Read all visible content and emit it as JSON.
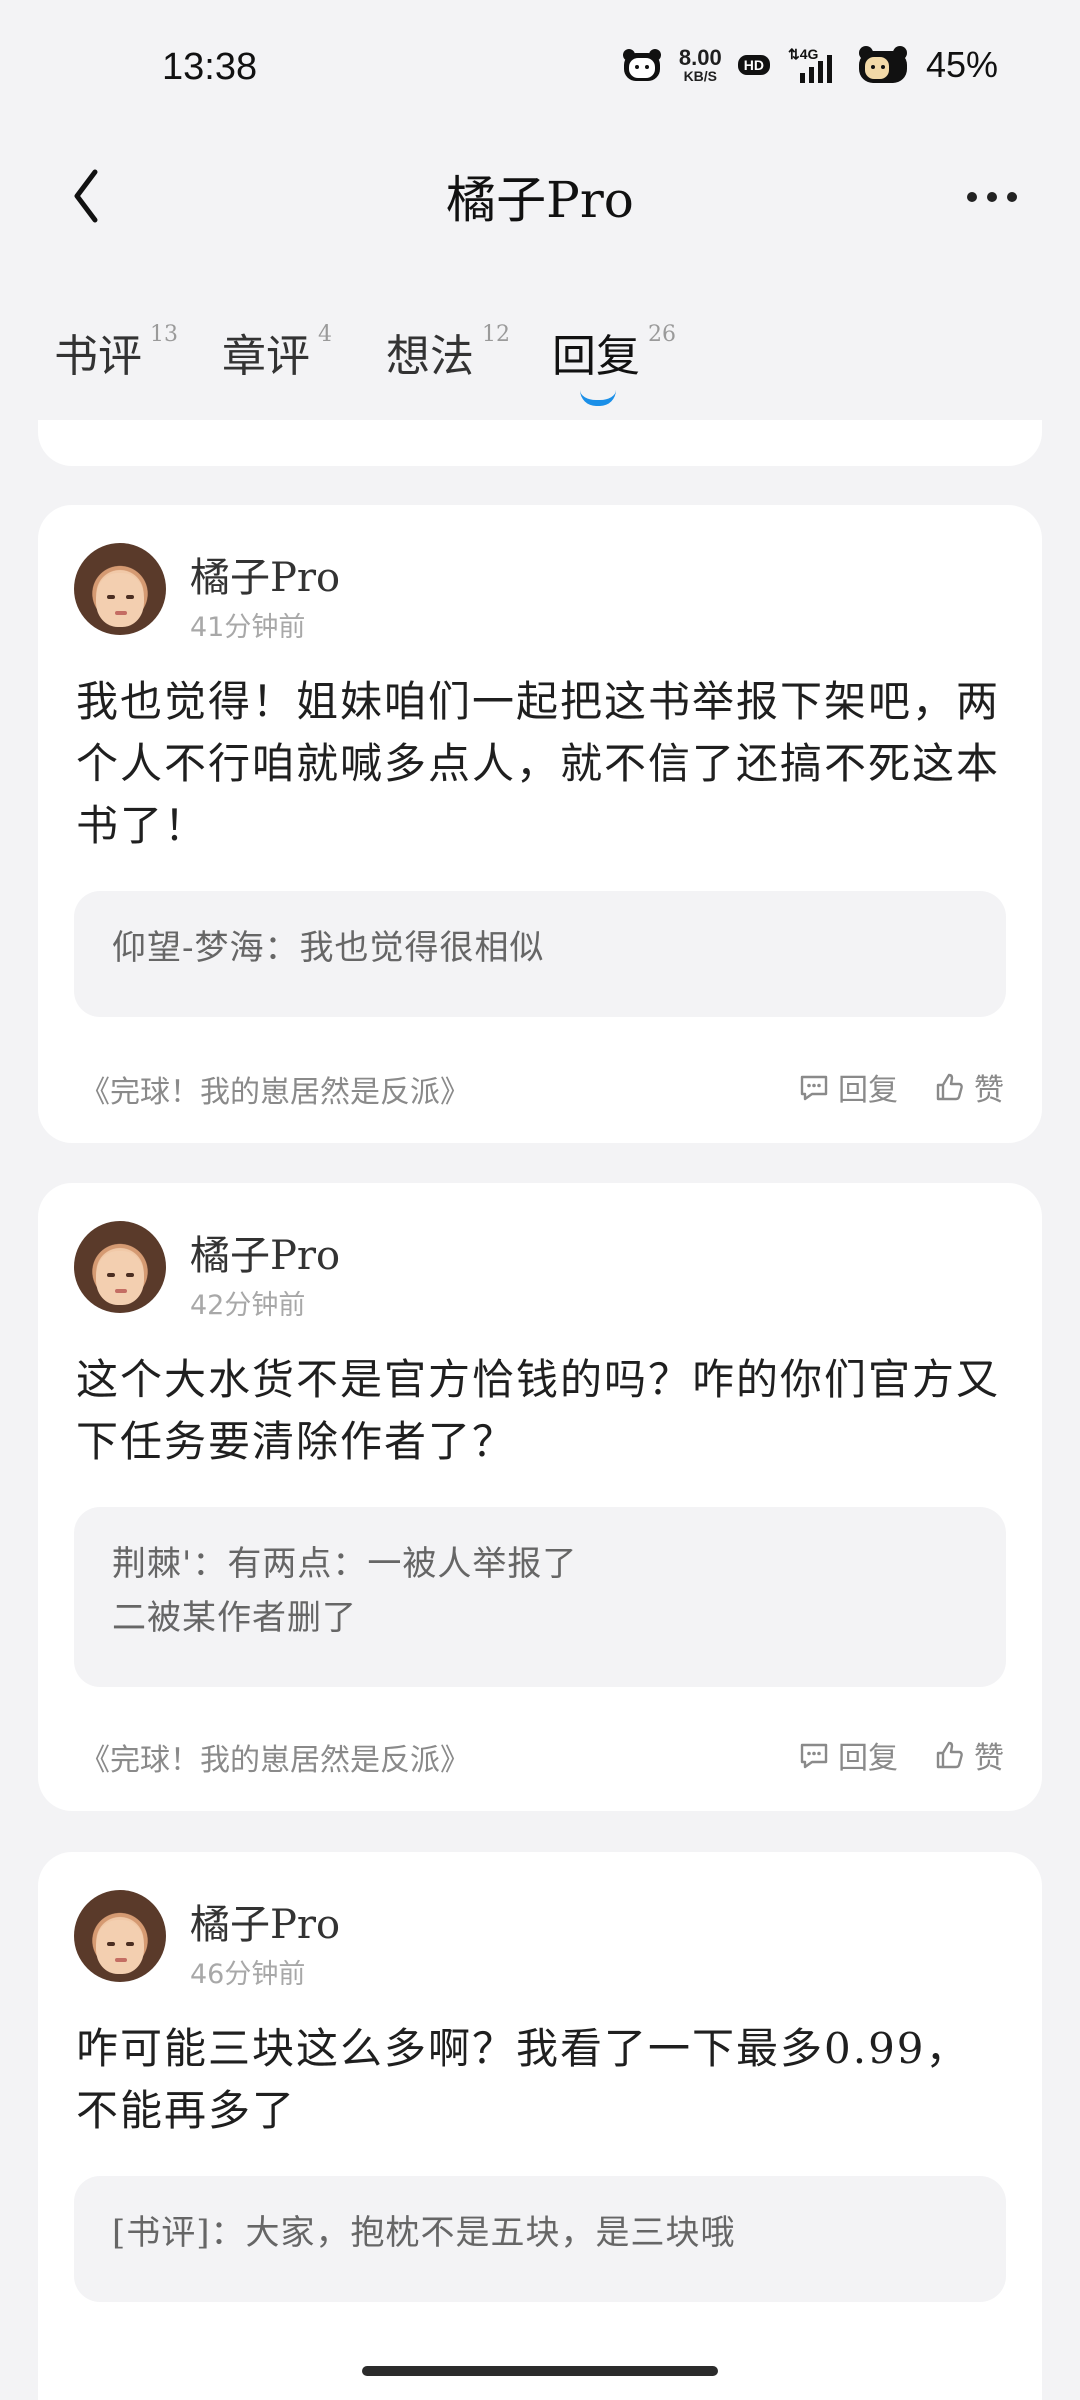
{
  "status": {
    "time": "13:38",
    "net_speed_value": "8.00",
    "net_speed_unit": "KB/S",
    "hd": "HD",
    "network": "4G",
    "battery": "45%"
  },
  "header": {
    "title": "橘子Pro"
  },
  "tabs": [
    {
      "label": "书评",
      "count": "13"
    },
    {
      "label": "章评",
      "count": "4"
    },
    {
      "label": "想法",
      "count": "12"
    },
    {
      "label": "回复",
      "count": "26"
    }
  ],
  "cards": [
    {
      "author": "橘子Pro",
      "time_ago": "41分钟前",
      "content": "我也觉得！姐妹咱们一起把这书举报下架吧，两个人不行咱就喊多点人，就不信了还搞不死这本书了！",
      "quote": "仰望-梦海：我也觉得很相似",
      "book": "《完球！我的崽居然是反派》",
      "reply_label": "回复",
      "like_label": "赞"
    },
    {
      "author": "橘子Pro",
      "time_ago": "42分钟前",
      "content": "这个大水货不是官方恰钱的吗？咋的你们官方又下任务要清除作者了？",
      "quote": "荆棘'：有两点：一被人举报了\n二被某作者删了",
      "book": "《完球！我的崽居然是反派》",
      "reply_label": "回复",
      "like_label": "赞"
    },
    {
      "author": "橘子Pro",
      "time_ago": "46分钟前",
      "content": "咋可能三块这么多啊？我看了一下最多0.99，不能再多了",
      "quote": "[书评]：大家，抱枕不是五块，是三块哦"
    }
  ]
}
